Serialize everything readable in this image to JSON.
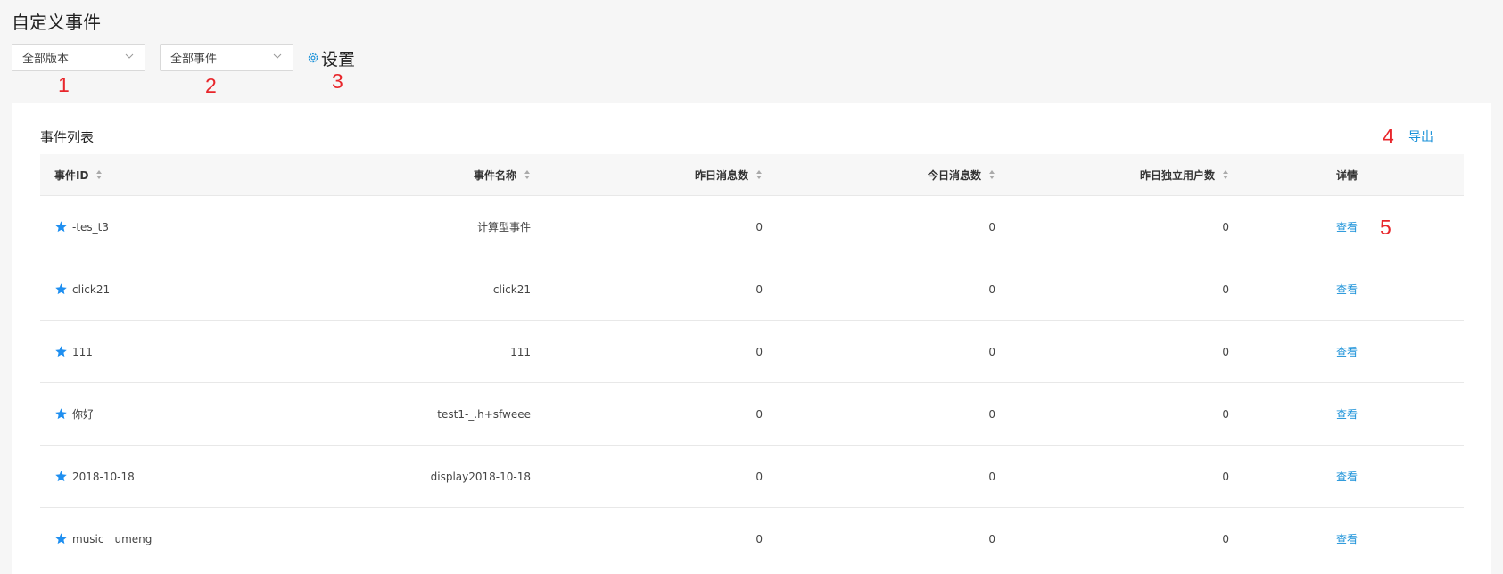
{
  "page_title": "自定义事件",
  "filters": {
    "version_select": "全部版本",
    "event_select": "全部事件",
    "settings_label": "设置"
  },
  "annotations": [
    "1",
    "2",
    "3",
    "4",
    "5"
  ],
  "panel": {
    "title": "事件列表",
    "export_label": "导出"
  },
  "table": {
    "headers": [
      "事件ID",
      "事件名称",
      "昨日消息数",
      "今日消息数",
      "昨日独立用户数",
      "详情"
    ],
    "rows": [
      {
        "id": "-tes_t3",
        "name": "计算型事件",
        "yesterday_msgs": "0",
        "today_msgs": "0",
        "yesterday_users": "0",
        "detail": "查看"
      },
      {
        "id": "click21",
        "name": "click21",
        "yesterday_msgs": "0",
        "today_msgs": "0",
        "yesterday_users": "0",
        "detail": "查看"
      },
      {
        "id": "111",
        "name": "111",
        "yesterday_msgs": "0",
        "today_msgs": "0",
        "yesterday_users": "0",
        "detail": "查看"
      },
      {
        "id": "你好",
        "name": "test1-_.h+sfweee",
        "yesterday_msgs": "0",
        "today_msgs": "0",
        "yesterday_users": "0",
        "detail": "查看"
      },
      {
        "id": "2018-10-18",
        "name": "display2018-10-18",
        "yesterday_msgs": "0",
        "today_msgs": "0",
        "yesterday_users": "0",
        "detail": "查看"
      },
      {
        "id": "music__umeng",
        "name": "",
        "yesterday_msgs": "0",
        "today_msgs": "0",
        "yesterday_users": "0",
        "detail": "查看"
      }
    ]
  },
  "colors": {
    "accent": "#1890d8",
    "star": "#1f8ff0",
    "annotation": "#e8262b"
  },
  "icons": [
    "chevron-down-icon",
    "gear-icon",
    "sort-icon",
    "star-icon"
  ]
}
